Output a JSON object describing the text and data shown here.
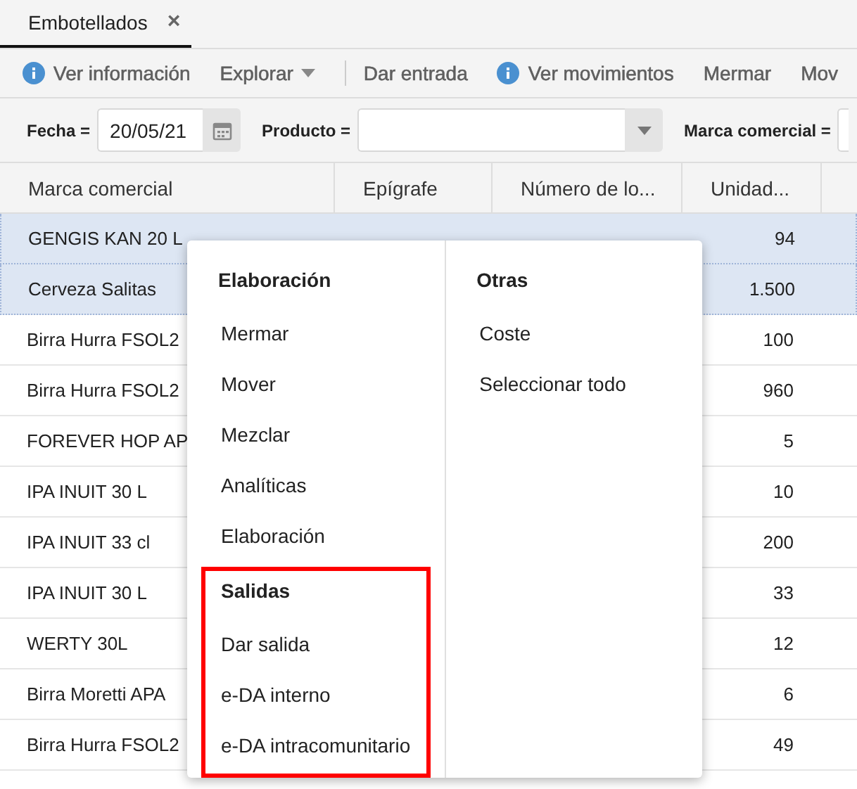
{
  "tabs": [
    {
      "label": "Embotellados",
      "selected": true,
      "close": "×"
    }
  ],
  "toolbar": [
    {
      "kind": "info",
      "label": "Ver información"
    },
    {
      "kind": "dropdown",
      "label": "Explorar"
    },
    {
      "kind": "separator"
    },
    {
      "kind": "plain",
      "label": "Dar entrada"
    },
    {
      "kind": "info",
      "label": "Ver movimientos"
    },
    {
      "kind": "plain",
      "label": "Mermar"
    },
    {
      "kind": "plain",
      "label": "Mov"
    }
  ],
  "filters": [
    {
      "kind": "date",
      "label": "Fecha =",
      "value": "20/05/21"
    },
    {
      "kind": "select",
      "label": "Producto ="
    },
    {
      "kind": "cut",
      "label": "Marca comercial ="
    }
  ],
  "table": {
    "columns": [
      "Marca comercial",
      "Epígrafe",
      "Número de lo...",
      "Unidad..."
    ],
    "rows": [
      {
        "marca": "GENGIS KAN 20 L",
        "unidades": "94",
        "selected": true
      },
      {
        "marca": "Cerveza Salitas",
        "unidades": "1.500",
        "selected": true
      },
      {
        "marca": "Birra Hurra FSOL2",
        "unidades": "100",
        "selected": false
      },
      {
        "marca": "Birra Hurra FSOL2",
        "unidades": "960",
        "selected": false
      },
      {
        "marca": "FOREVER HOP AP",
        "unidades": "5",
        "selected": false
      },
      {
        "marca": "IPA INUIT 30 L",
        "unidades": "10",
        "selected": false
      },
      {
        "marca": "IPA INUIT 33 cl",
        "unidades": "200",
        "selected": false
      },
      {
        "marca": "IPA INUIT 30 L",
        "unidades": "33",
        "selected": false
      },
      {
        "marca": "WERTY 30L",
        "unidades": "12",
        "selected": false
      },
      {
        "marca": "Birra Moretti APA",
        "unidades": "6",
        "selected": false
      },
      {
        "marca": "Birra Hurra FSOL2",
        "unidades": "49",
        "selected": false
      }
    ]
  },
  "context_menu": {
    "columns": [
      {
        "sections": [
          {
            "title": "Elaboración",
            "highlighted": false,
            "items": [
              "Mermar",
              "Mover",
              "Mezclar",
              "Analíticas",
              "Elaboración"
            ]
          },
          {
            "title": "Salidas",
            "highlighted": true,
            "items": [
              "Dar salida",
              "e-DA interno",
              "e-DA intracomunitario"
            ]
          }
        ]
      },
      {
        "sections": [
          {
            "title": "Otras",
            "highlighted": false,
            "items": [
              "Coste",
              "Seleccionar todo"
            ]
          }
        ]
      }
    ]
  }
}
